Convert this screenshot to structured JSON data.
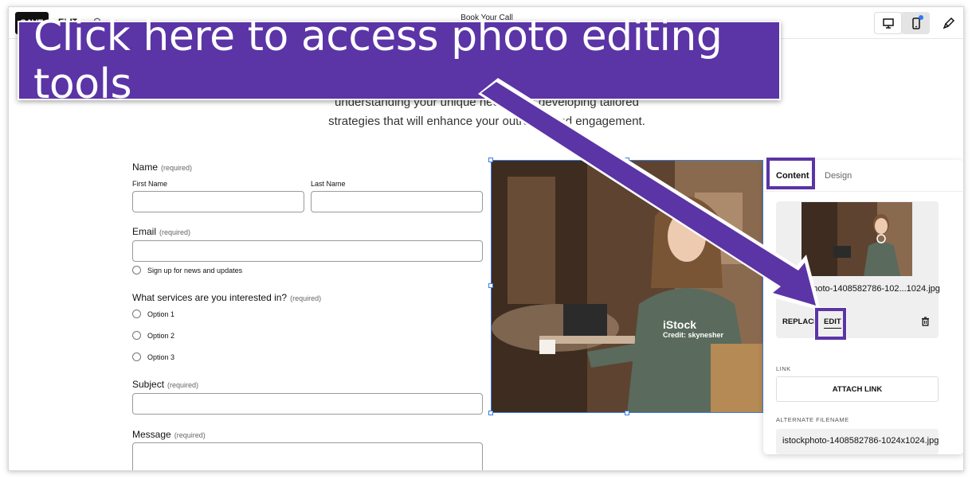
{
  "toolbar": {
    "save_label": "SAVE",
    "exit_label": "EXIT",
    "page_title": "Book Your Call"
  },
  "intro": {
    "line1": "understanding your unique needs and developing tailored",
    "line2": "strategies that will enhance your outreach and engagement."
  },
  "form": {
    "name_label": "Name",
    "required": "(required)",
    "first_name": "First Name",
    "last_name": "Last Name",
    "email_label": "Email",
    "newsletter": "Sign up for news and updates",
    "services_label": "What services are you interested in?",
    "options": [
      "Option 1",
      "Option 2",
      "Option 3"
    ],
    "subject_label": "Subject",
    "message_label": "Message"
  },
  "image": {
    "watermark": "iStock",
    "credit": "Credit: skynesher"
  },
  "panel": {
    "tab_content": "Content",
    "tab_design": "Design",
    "filename": "istockphoto-1408582786-102...1024.jpg",
    "replace": "REPLACE",
    "edit": "EDIT",
    "link_label": "LINK",
    "attach_link": "ATTACH LINK",
    "alt_label": "ALTERNATE FILENAME",
    "alt_value": "istockphoto-1408582786-1024x1024.jpg"
  },
  "callout": {
    "text": "Click here to access photo editing tools",
    "color": "#5b34a6"
  },
  "icons": [
    "undo-icon",
    "redo-icon",
    "desktop-icon",
    "mobile-icon",
    "brush-icon",
    "trash-icon"
  ]
}
